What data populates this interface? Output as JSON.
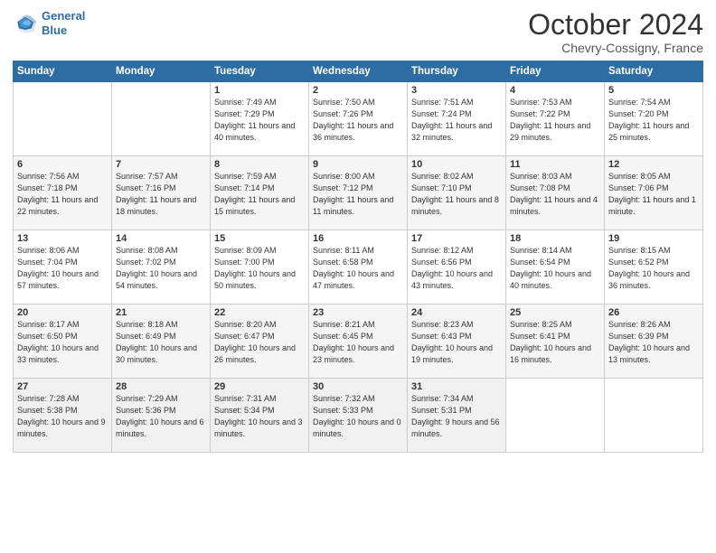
{
  "header": {
    "logo_line1": "General",
    "logo_line2": "Blue",
    "title": "October 2024",
    "location": "Chevry-Cossigny, France"
  },
  "weekdays": [
    "Sunday",
    "Monday",
    "Tuesday",
    "Wednesday",
    "Thursday",
    "Friday",
    "Saturday"
  ],
  "weeks": [
    [
      {
        "num": "",
        "info": ""
      },
      {
        "num": "",
        "info": ""
      },
      {
        "num": "1",
        "info": "Sunrise: 7:49 AM\nSunset: 7:29 PM\nDaylight: 11 hours\nand 40 minutes."
      },
      {
        "num": "2",
        "info": "Sunrise: 7:50 AM\nSunset: 7:26 PM\nDaylight: 11 hours\nand 36 minutes."
      },
      {
        "num": "3",
        "info": "Sunrise: 7:51 AM\nSunset: 7:24 PM\nDaylight: 11 hours\nand 32 minutes."
      },
      {
        "num": "4",
        "info": "Sunrise: 7:53 AM\nSunset: 7:22 PM\nDaylight: 11 hours\nand 29 minutes."
      },
      {
        "num": "5",
        "info": "Sunrise: 7:54 AM\nSunset: 7:20 PM\nDaylight: 11 hours\nand 25 minutes."
      }
    ],
    [
      {
        "num": "6",
        "info": "Sunrise: 7:56 AM\nSunset: 7:18 PM\nDaylight: 11 hours\nand 22 minutes."
      },
      {
        "num": "7",
        "info": "Sunrise: 7:57 AM\nSunset: 7:16 PM\nDaylight: 11 hours\nand 18 minutes."
      },
      {
        "num": "8",
        "info": "Sunrise: 7:59 AM\nSunset: 7:14 PM\nDaylight: 11 hours\nand 15 minutes."
      },
      {
        "num": "9",
        "info": "Sunrise: 8:00 AM\nSunset: 7:12 PM\nDaylight: 11 hours\nand 11 minutes."
      },
      {
        "num": "10",
        "info": "Sunrise: 8:02 AM\nSunset: 7:10 PM\nDaylight: 11 hours\nand 8 minutes."
      },
      {
        "num": "11",
        "info": "Sunrise: 8:03 AM\nSunset: 7:08 PM\nDaylight: 11 hours\nand 4 minutes."
      },
      {
        "num": "12",
        "info": "Sunrise: 8:05 AM\nSunset: 7:06 PM\nDaylight: 11 hours\nand 1 minute."
      }
    ],
    [
      {
        "num": "13",
        "info": "Sunrise: 8:06 AM\nSunset: 7:04 PM\nDaylight: 10 hours\nand 57 minutes."
      },
      {
        "num": "14",
        "info": "Sunrise: 8:08 AM\nSunset: 7:02 PM\nDaylight: 10 hours\nand 54 minutes."
      },
      {
        "num": "15",
        "info": "Sunrise: 8:09 AM\nSunset: 7:00 PM\nDaylight: 10 hours\nand 50 minutes."
      },
      {
        "num": "16",
        "info": "Sunrise: 8:11 AM\nSunset: 6:58 PM\nDaylight: 10 hours\nand 47 minutes."
      },
      {
        "num": "17",
        "info": "Sunrise: 8:12 AM\nSunset: 6:56 PM\nDaylight: 10 hours\nand 43 minutes."
      },
      {
        "num": "18",
        "info": "Sunrise: 8:14 AM\nSunset: 6:54 PM\nDaylight: 10 hours\nand 40 minutes."
      },
      {
        "num": "19",
        "info": "Sunrise: 8:15 AM\nSunset: 6:52 PM\nDaylight: 10 hours\nand 36 minutes."
      }
    ],
    [
      {
        "num": "20",
        "info": "Sunrise: 8:17 AM\nSunset: 6:50 PM\nDaylight: 10 hours\nand 33 minutes."
      },
      {
        "num": "21",
        "info": "Sunrise: 8:18 AM\nSunset: 6:49 PM\nDaylight: 10 hours\nand 30 minutes."
      },
      {
        "num": "22",
        "info": "Sunrise: 8:20 AM\nSunset: 6:47 PM\nDaylight: 10 hours\nand 26 minutes."
      },
      {
        "num": "23",
        "info": "Sunrise: 8:21 AM\nSunset: 6:45 PM\nDaylight: 10 hours\nand 23 minutes."
      },
      {
        "num": "24",
        "info": "Sunrise: 8:23 AM\nSunset: 6:43 PM\nDaylight: 10 hours\nand 19 minutes."
      },
      {
        "num": "25",
        "info": "Sunrise: 8:25 AM\nSunset: 6:41 PM\nDaylight: 10 hours\nand 16 minutes."
      },
      {
        "num": "26",
        "info": "Sunrise: 8:26 AM\nSunset: 6:39 PM\nDaylight: 10 hours\nand 13 minutes."
      }
    ],
    [
      {
        "num": "27",
        "info": "Sunrise: 7:28 AM\nSunset: 5:38 PM\nDaylight: 10 hours\nand 9 minutes."
      },
      {
        "num": "28",
        "info": "Sunrise: 7:29 AM\nSunset: 5:36 PM\nDaylight: 10 hours\nand 6 minutes."
      },
      {
        "num": "29",
        "info": "Sunrise: 7:31 AM\nSunset: 5:34 PM\nDaylight: 10 hours\nand 3 minutes."
      },
      {
        "num": "30",
        "info": "Sunrise: 7:32 AM\nSunset: 5:33 PM\nDaylight: 10 hours\nand 0 minutes."
      },
      {
        "num": "31",
        "info": "Sunrise: 7:34 AM\nSunset: 5:31 PM\nDaylight: 9 hours\nand 56 minutes."
      },
      {
        "num": "",
        "info": ""
      },
      {
        "num": "",
        "info": ""
      }
    ]
  ]
}
